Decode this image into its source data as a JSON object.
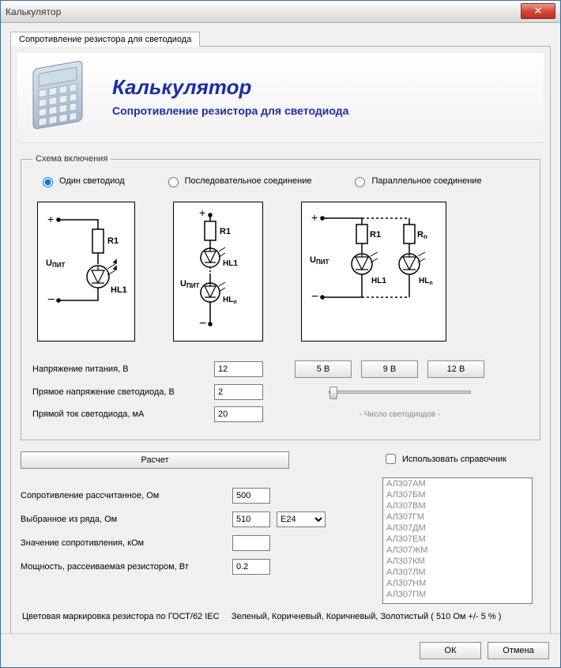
{
  "window": {
    "title": "Калькулятор"
  },
  "tab": {
    "label": "Сопротивление резистора для светодиода"
  },
  "hero": {
    "title": "Калькулятор",
    "subtitle": "Сопротивление резистора для светодиода"
  },
  "scheme": {
    "legend": "Схема включения",
    "opt_single": "Один светодиод",
    "opt_series": "Последовательное соединение",
    "opt_parallel": "Параллельное соединение"
  },
  "inputs": {
    "supply_label": "Напряжение питания, В",
    "supply_value": "12",
    "fwdv_label": "Прямое напряжение светодиода, В",
    "fwdv_value": "2",
    "fwdi_label": "Прямой ток светодиода, мА",
    "fwdi_value": "20",
    "preset5": "5 В",
    "preset9": "9 В",
    "preset12": "12 В",
    "led_count_caption": "- Число светодиодов -"
  },
  "calc_button": "Расчет",
  "results": {
    "r_calc_label": "Сопротивление рассчитанное, Ом",
    "r_calc_value": "500",
    "r_std_label": "Выбранное из ряда, Ом",
    "r_std_value": "510",
    "series_value": "E24",
    "r_kohm_label": "Значение сопротивления, кОм",
    "r_kohm_value": "",
    "power_label": "Мощность, рассеиваемая резистором, Вт",
    "power_value": "0.2"
  },
  "ref": {
    "use_label": "Использовать справочник",
    "items": [
      "АЛ307АМ",
      "АЛ307БМ",
      "АЛ307ВМ",
      "АЛ307ГМ",
      "АЛ307ДМ",
      "АЛ307ЕМ",
      "АЛ307ЖМ",
      "АЛ307КМ",
      "АЛ307ЛМ",
      "АЛ307НМ",
      "АЛ307ПМ"
    ]
  },
  "colorcode": {
    "label": "Цветовая маркировка резистора по ГОСТ/62 IEC",
    "value": "Зеленый, Коричневый, Коричневый, Золотистый ( 510 Ом  +/- 5 % )"
  },
  "footer": {
    "ok": "ОК",
    "cancel": "Отмена"
  }
}
